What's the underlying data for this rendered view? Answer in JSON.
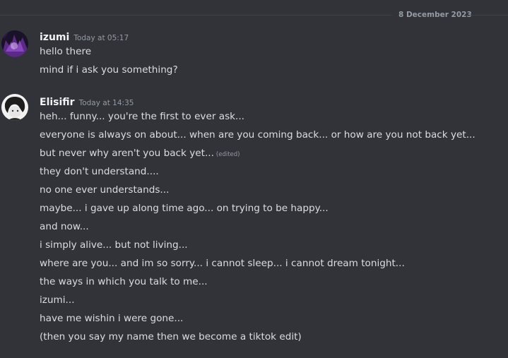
{
  "date_divider": "8 December 2023",
  "messages": [
    {
      "author": "izumi",
      "timestamp": "Today at 05:17",
      "lines": [
        {
          "text": "hello there",
          "edited": ""
        },
        {
          "text": "mind if i ask you something?",
          "edited": ""
        }
      ]
    },
    {
      "author": "Elisifir",
      "timestamp": "Today at 14:35",
      "lines": [
        {
          "text": "heh... funny... you're the first to ever ask...",
          "edited": ""
        },
        {
          "text": "everyone is always on about... when are you coming back... or how are you not back yet...",
          "edited": ""
        },
        {
          "text": "but never why aren't you back yet...",
          "edited": "(edited)"
        },
        {
          "text": "they don't understand....",
          "edited": ""
        },
        {
          "text": "no one ever understands...",
          "edited": ""
        },
        {
          "text": "maybe... i gave up along time ago... on trying to be happy...",
          "edited": ""
        },
        {
          "text": "and now...",
          "edited": ""
        },
        {
          "text": "i simply alive... but not living...",
          "edited": ""
        },
        {
          "text": "where are you... and im so sorry... i cannot sleep... i cannot dream tonight...",
          "edited": ""
        },
        {
          "text": "the ways in which you talk to me...",
          "edited": ""
        },
        {
          "text": "izumi...",
          "edited": ""
        },
        {
          "text": "have me wishin i were gone...",
          "edited": ""
        },
        {
          "text": "(then you say my name then we become a tiktok edit)",
          "edited": ""
        }
      ]
    }
  ]
}
